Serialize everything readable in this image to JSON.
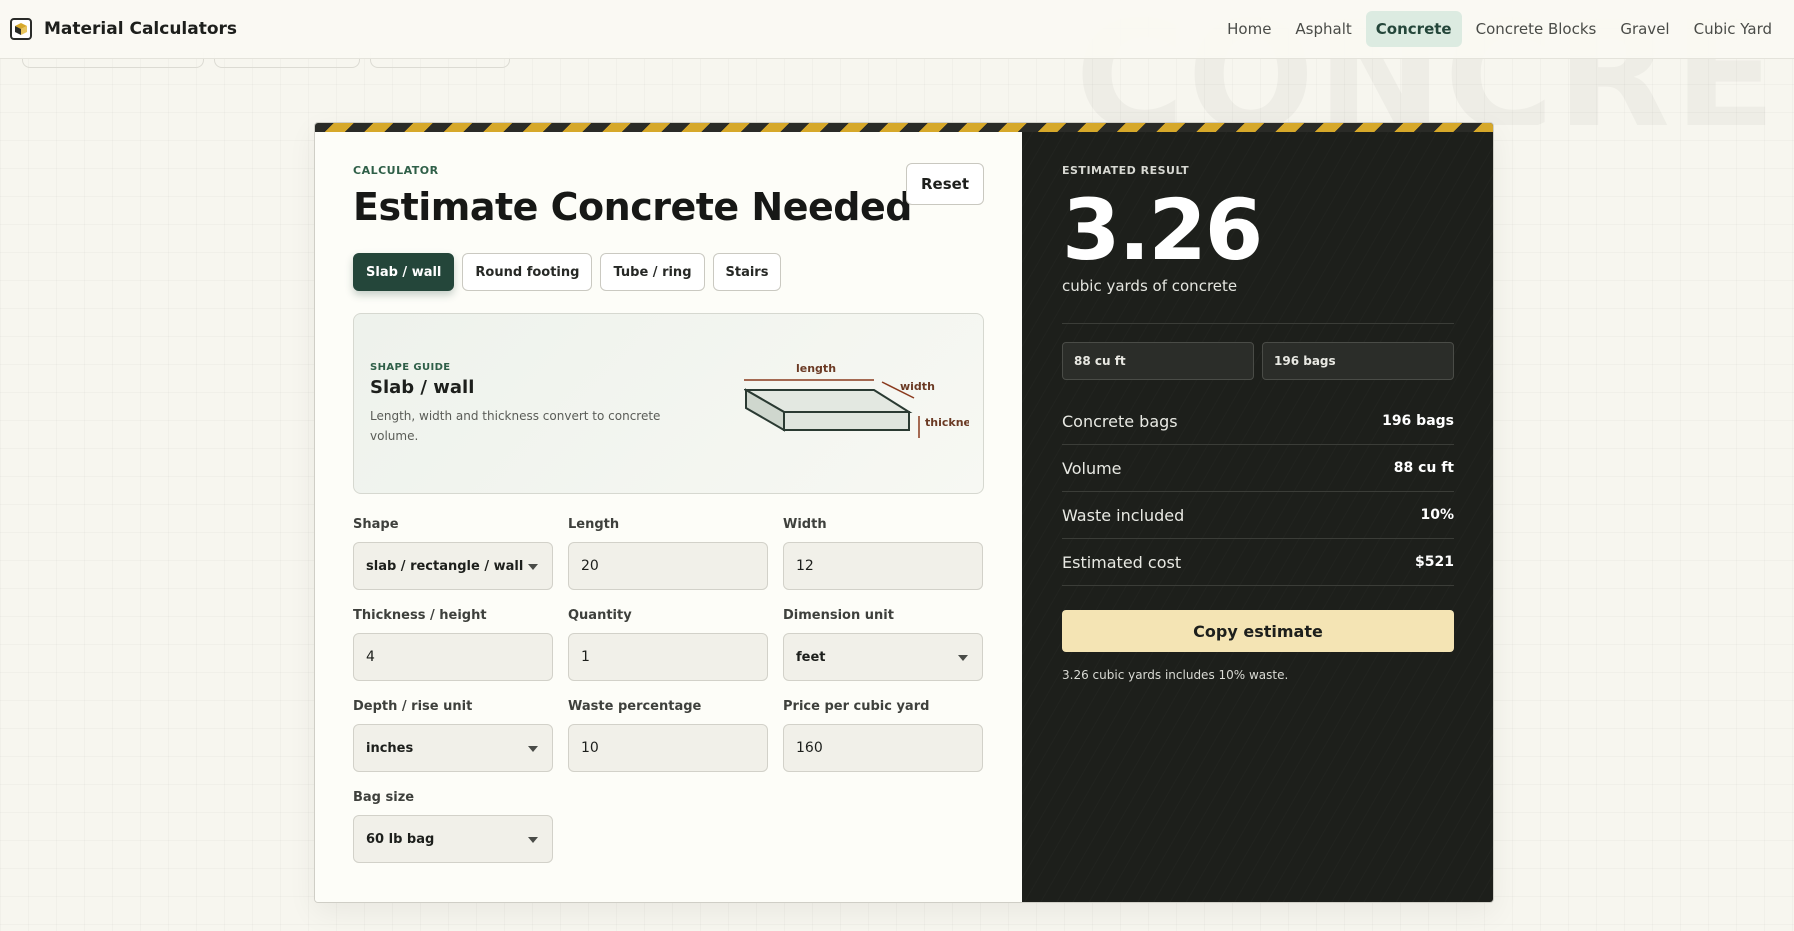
{
  "nav": {
    "brand": "Material Calculators",
    "links": [
      "Home",
      "Asphalt",
      "Concrete",
      "Concrete Blocks",
      "Gravel",
      "Cubic Yard"
    ],
    "active": "Concrete"
  },
  "background_word": "CONCRETE",
  "calculator": {
    "eyebrow": "CALCULATOR",
    "title": "Estimate Concrete Needed",
    "reset_label": "Reset",
    "shape_tabs": [
      "Slab / wall",
      "Round footing",
      "Tube / ring",
      "Stairs"
    ],
    "active_tab": "Slab / wall",
    "guide": {
      "eyebrow": "SHAPE GUIDE",
      "title": "Slab / wall",
      "text": "Length, width and thickness convert to concrete volume.",
      "labels": {
        "length": "length",
        "width": "width",
        "thickness": "thickness"
      }
    },
    "fields": [
      {
        "label": "Shape",
        "value": "slab / rectangle / wall",
        "type": "select"
      },
      {
        "label": "Length",
        "value": "20",
        "type": "input"
      },
      {
        "label": "Width",
        "value": "12",
        "type": "input"
      },
      {
        "label": "Thickness / height",
        "value": "4",
        "type": "input"
      },
      {
        "label": "Quantity",
        "value": "1",
        "type": "input"
      },
      {
        "label": "Dimension unit",
        "value": "feet",
        "type": "select"
      },
      {
        "label": "Depth / rise unit",
        "value": "inches",
        "type": "select"
      },
      {
        "label": "Waste percentage",
        "value": "10",
        "type": "input"
      },
      {
        "label": "Price per cubic yard",
        "value": "160",
        "type": "input"
      },
      {
        "label": "Bag size",
        "value": "60 lb bag",
        "type": "select"
      }
    ]
  },
  "result": {
    "eyebrow": "ESTIMATED RESULT",
    "value": "3.26",
    "unit": "cubic yards of concrete",
    "chips": [
      "88 cu ft",
      "196 bags"
    ],
    "rows": [
      {
        "label": "Concrete bags",
        "value": "196 bags"
      },
      {
        "label": "Volume",
        "value": "88 cu ft"
      },
      {
        "label": "Waste included",
        "value": "10%"
      },
      {
        "label": "Estimated cost",
        "value": "$521"
      }
    ],
    "copy_label": "Copy estimate",
    "note": "3.26 cubic yards includes 10% waste."
  },
  "colors": {
    "accent_green": "#24463a",
    "dark_panel": "#1d1f1b",
    "copy_button": "#f4e4b4",
    "stripe_yellow": "#d6a82a",
    "guide_line": "#8a3a1e"
  }
}
